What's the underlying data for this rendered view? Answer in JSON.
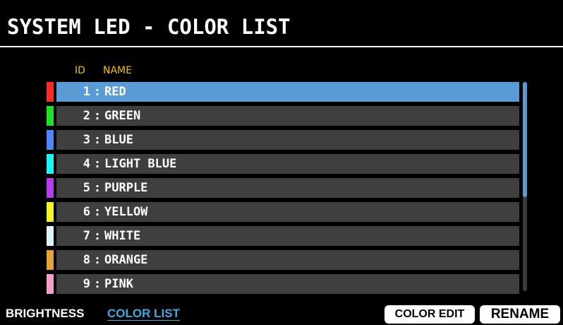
{
  "header": {
    "title": "SYSTEM LED - COLOR LIST"
  },
  "columns": {
    "id_label": "ID",
    "name_label": "NAME",
    "header_color": "#f2c200"
  },
  "list": {
    "separator": ":",
    "selected_index": 0,
    "selected_color": "#5b9bd5",
    "row_color": "#3f3f3f",
    "items": [
      {
        "id": "1",
        "name": "RED",
        "swatch": "#ff2a2a"
      },
      {
        "id": "2",
        "name": "GREEN",
        "swatch": "#22e02a"
      },
      {
        "id": "3",
        "name": "BLUE",
        "swatch": "#4f86ff"
      },
      {
        "id": "4",
        "name": "LIGHT BLUE",
        "swatch": "#1ef6f6"
      },
      {
        "id": "5",
        "name": "PURPLE",
        "swatch": "#b83cf0"
      },
      {
        "id": "6",
        "name": "YELLOW",
        "swatch": "#f4f42a"
      },
      {
        "id": "7",
        "name": "WHITE",
        "swatch": "#dff4ff"
      },
      {
        "id": "8",
        "name": "ORANGE",
        "swatch": "#e6a23a"
      },
      {
        "id": "9",
        "name": "PINK",
        "swatch": "#f2a0c8"
      }
    ]
  },
  "scrollbar": {
    "position": 0,
    "visible_fraction": 0.55,
    "thumb_color": "#5b9bd5"
  },
  "footer": {
    "brightness_label": "BRIGHTNESS",
    "color_list_label": "COLOR LIST",
    "active_tab_color": "#4aa8e0",
    "color_edit_label": "COLOR EDIT",
    "rename_label": "RENAME"
  }
}
